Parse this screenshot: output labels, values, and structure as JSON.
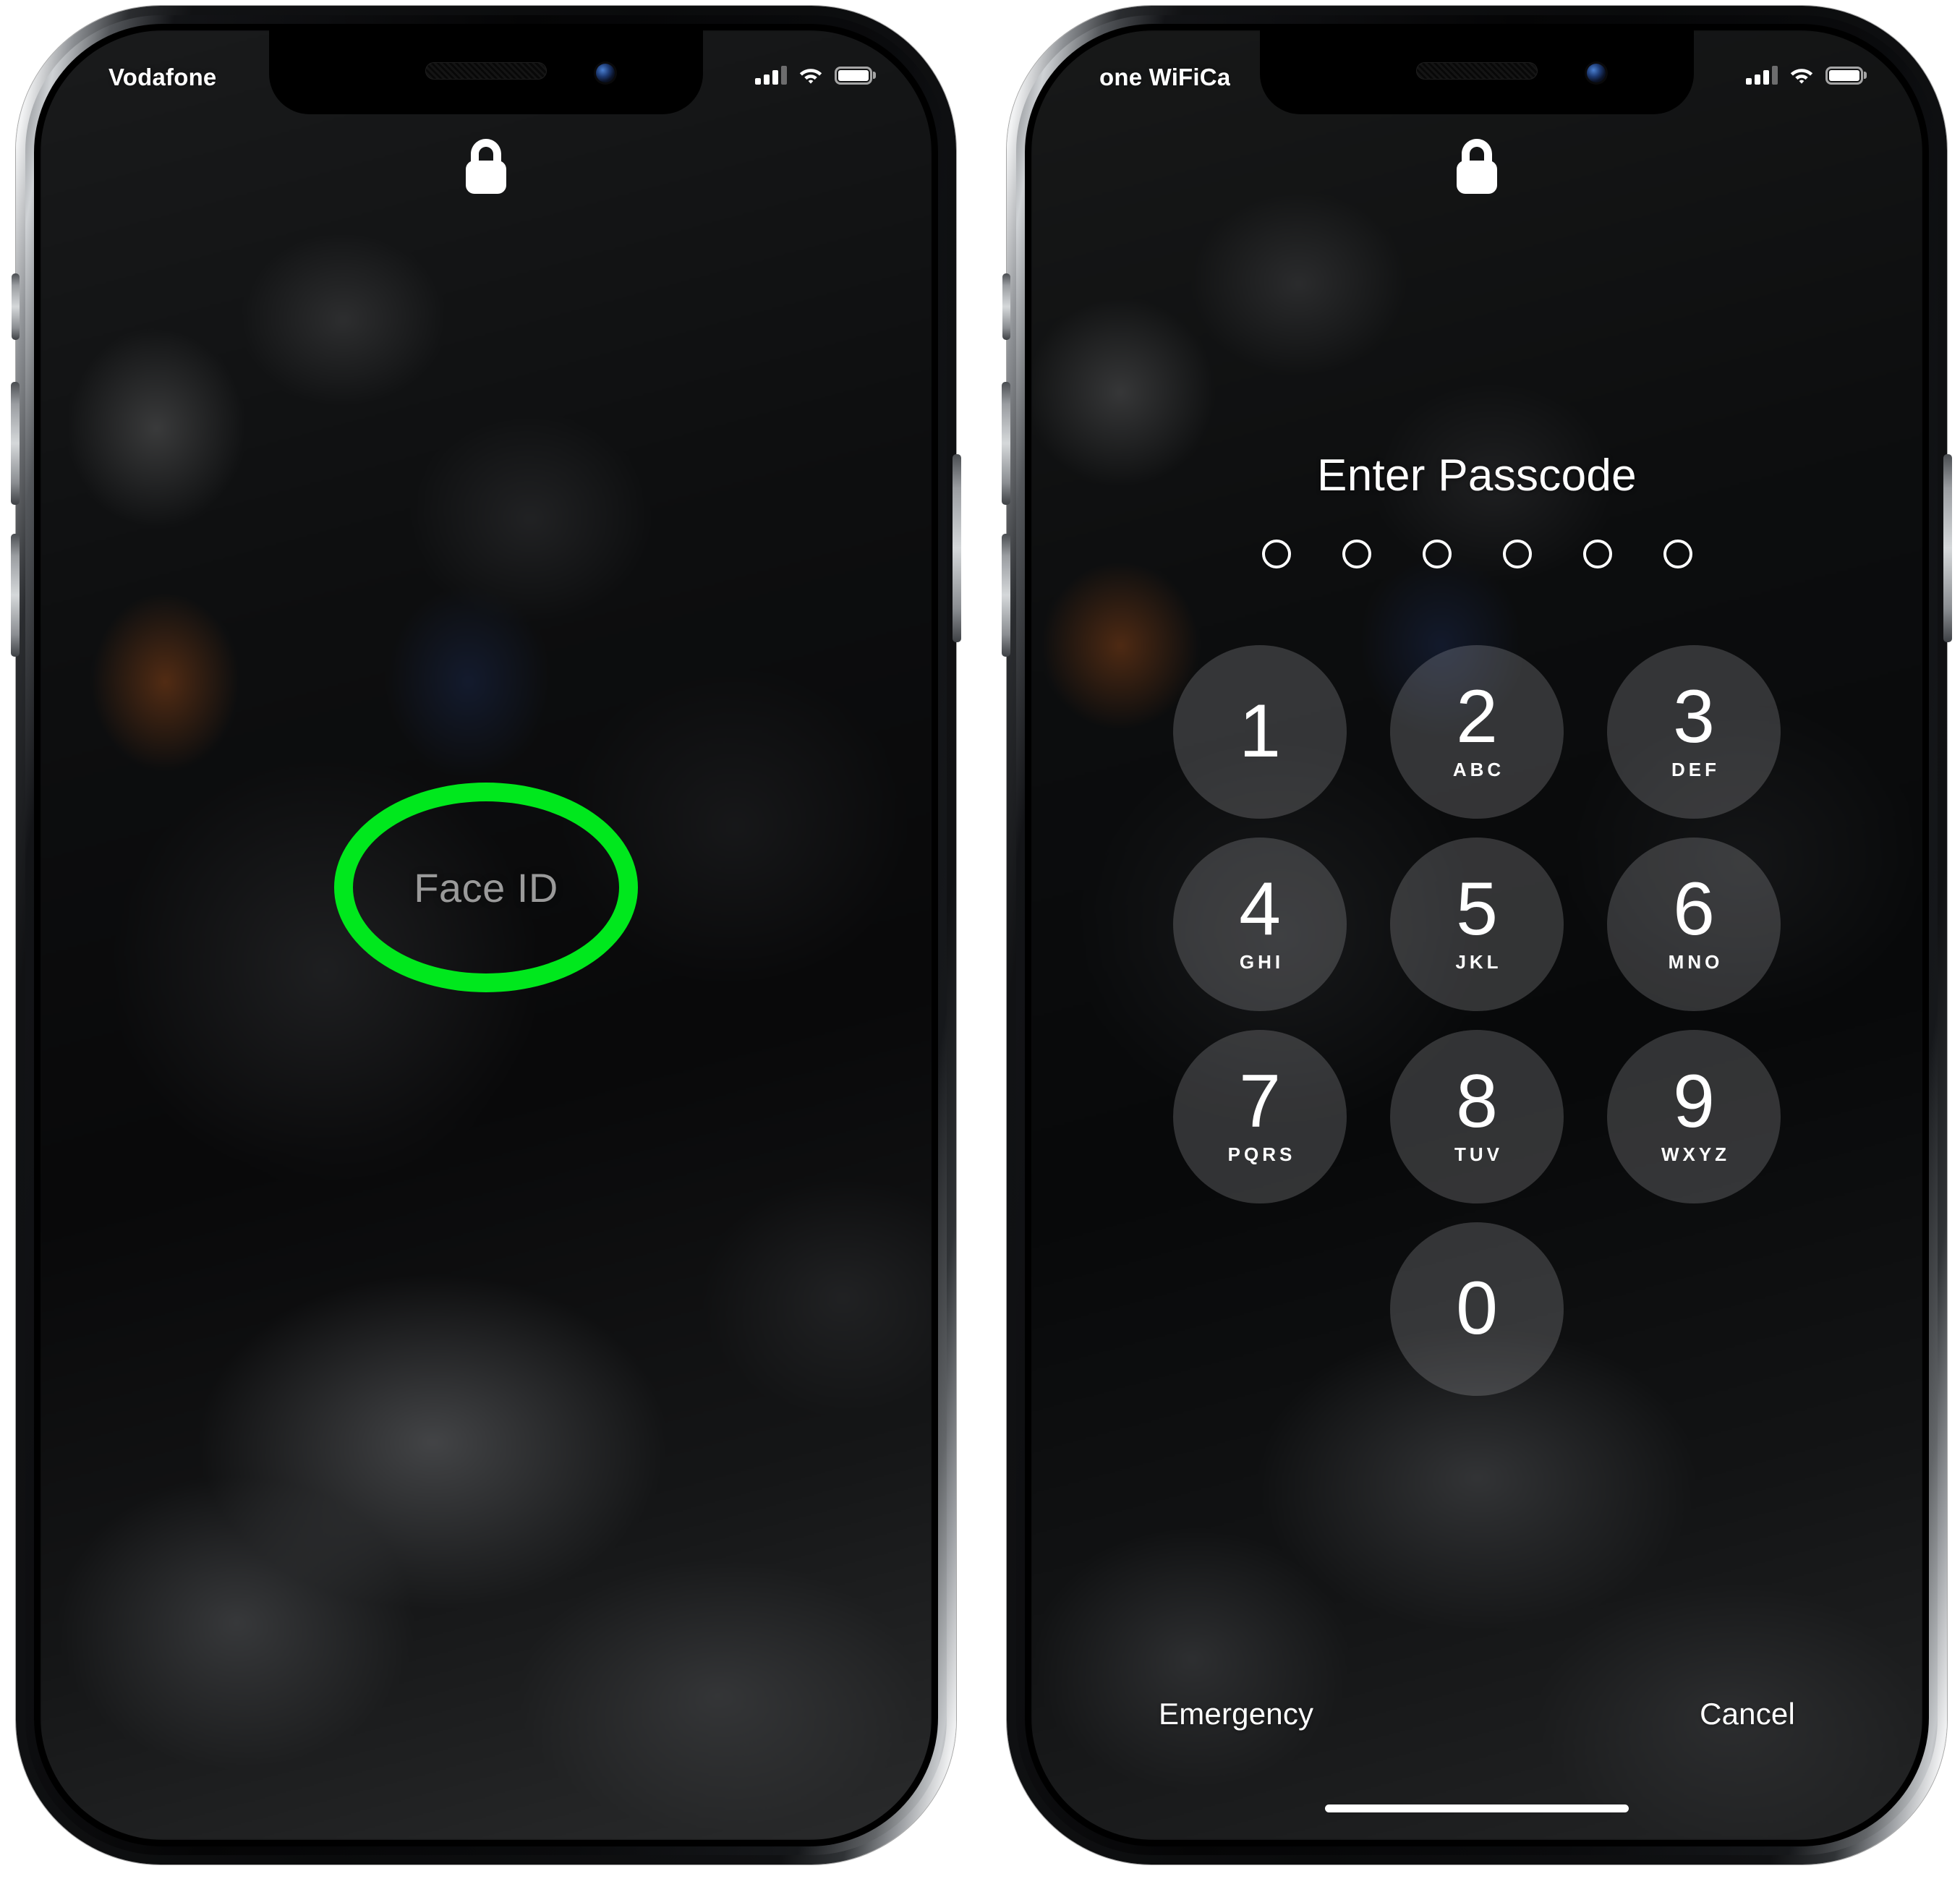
{
  "scene": {
    "background_color": "#ffffff",
    "description": "Two iPhone X devices side by side showing lock screen and passcode entry"
  },
  "phones": [
    {
      "id": "left",
      "status_bar": {
        "carrier": "Vodafone",
        "signal_icon": "cellular-signal-icon",
        "signal_bars_filled": 3,
        "signal_bars_total": 4,
        "wifi_icon": "wifi-icon",
        "battery_icon": "battery-icon",
        "battery_full": true
      },
      "lock_icon": "lock-closed-icon",
      "face_id": {
        "label": "Face ID",
        "label_color": "#9a9a9a",
        "highlight_color": "#00E81D",
        "highlight_shape": "ellipse"
      }
    },
    {
      "id": "right",
      "status_bar": {
        "carrier": "one WiFiCa",
        "signal_icon": "cellular-signal-icon",
        "signal_bars_filled": 3,
        "signal_bars_total": 4,
        "wifi_icon": "wifi-icon",
        "battery_icon": "battery-icon",
        "battery_full": true
      },
      "lock_icon": "lock-closed-icon",
      "passcode": {
        "title": "Enter Passcode",
        "dot_count": 6,
        "dots_filled": 0,
        "keys": [
          {
            "num": "1",
            "letters": ""
          },
          {
            "num": "2",
            "letters": "ABC"
          },
          {
            "num": "3",
            "letters": "DEF"
          },
          {
            "num": "4",
            "letters": "GHI"
          },
          {
            "num": "5",
            "letters": "JKL"
          },
          {
            "num": "6",
            "letters": "MNO"
          },
          {
            "num": "7",
            "letters": "PQRS"
          },
          {
            "num": "8",
            "letters": "TUV"
          },
          {
            "num": "9",
            "letters": "WXYZ"
          },
          {
            "num": "0",
            "letters": ""
          }
        ],
        "emergency_label": "Emergency",
        "cancel_label": "Cancel"
      }
    }
  ]
}
